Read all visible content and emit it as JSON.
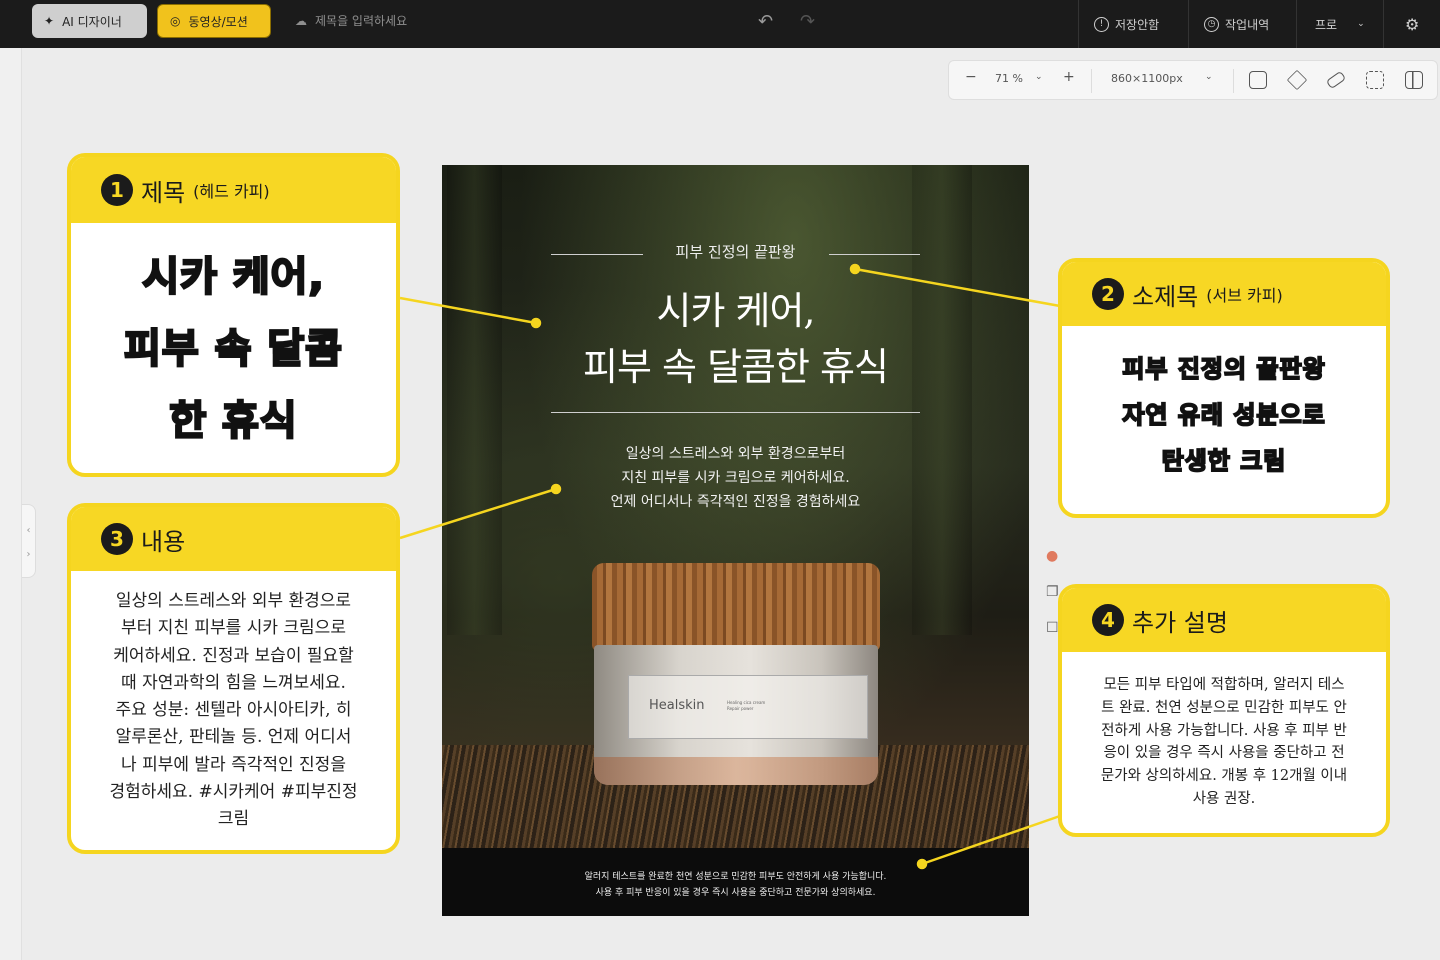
{
  "topbar": {
    "ai_designer": "AI 디자이너",
    "video_motion": "동영상/모션",
    "title_placeholder": "제목을 입력하세요",
    "unsaved": "저장안함",
    "history": "작업내역",
    "pro": "프로"
  },
  "subbar": {
    "zoom": "71 %",
    "canvas_size": "860×1100px"
  },
  "poster": {
    "subtitle": "피부 진정의 끝판왕",
    "title_line1": "시카 케어,",
    "title_line2": "피부 속 달콤한 휴식",
    "body_line1": "일상의 스트레스와 외부 환경으로부터",
    "body_line2": "지친 피부를 시카 크림으로 케어하세요.",
    "body_line3": "언제 어디서나 즉각적인 진정을 경험하세요",
    "product_brand": "Healskin",
    "product_name_1": "Healing cica cream",
    "product_name_2": "Repair power",
    "footer_line1": "알러지 테스트를 완료한 천연 성분으로 민감한 피부도 안전하게 사용 가능합니다.",
    "footer_line2": "사용 후 피부 반응이 있을 경우 즉시 사용을 중단하고 전문가와 상의하세요."
  },
  "callouts": {
    "c1": {
      "number": "1",
      "title": "제목",
      "title_sub": "(헤드 카피)",
      "line1": "시카 케어,",
      "line2": "피부 속 달콤",
      "line3": "한 휴식"
    },
    "c2": {
      "number": "2",
      "title": "소제목",
      "title_sub": "(서브 카피)",
      "line1": "피부 진정의 끝판왕",
      "line2": "자연 유래 성분으로",
      "line3": "탄생한 크림"
    },
    "c3": {
      "number": "3",
      "title": "내용",
      "lines": [
        "일상의 스트레스와 외부 환경으로",
        "부터 지친 피부를 시카 크림으로",
        "케어하세요. 진정과 보습이 필요할",
        "때 자연과학의 힘을 느껴보세요.",
        "주요 성분: 센텔라 아시아티카, 히",
        "알루론산, 판테놀 등. 언제 어디서",
        "나 피부에 발라 즉각적인 진정을",
        "경험하세요. #시카케어 #피부진정",
        "크림"
      ]
    },
    "c4": {
      "number": "4",
      "title": "추가 설명",
      "lines": [
        "모든 피부 타입에 적합하며, 알러지 테스",
        "트 완료. 천연 성분으로 민감한 피부도 안",
        "전하게 사용 가능합니다. 사용 후 피부 반",
        "응이 있을 경우 즉시 사용을 중단하고 전",
        "문가와 상의하세요. 개봉 후 12개월 이내",
        "사용 권장."
      ]
    }
  },
  "colors": {
    "accent_yellow": "#f7d724",
    "topbar_bg": "#1b1b1b",
    "canvas_bg": "#ececec"
  }
}
